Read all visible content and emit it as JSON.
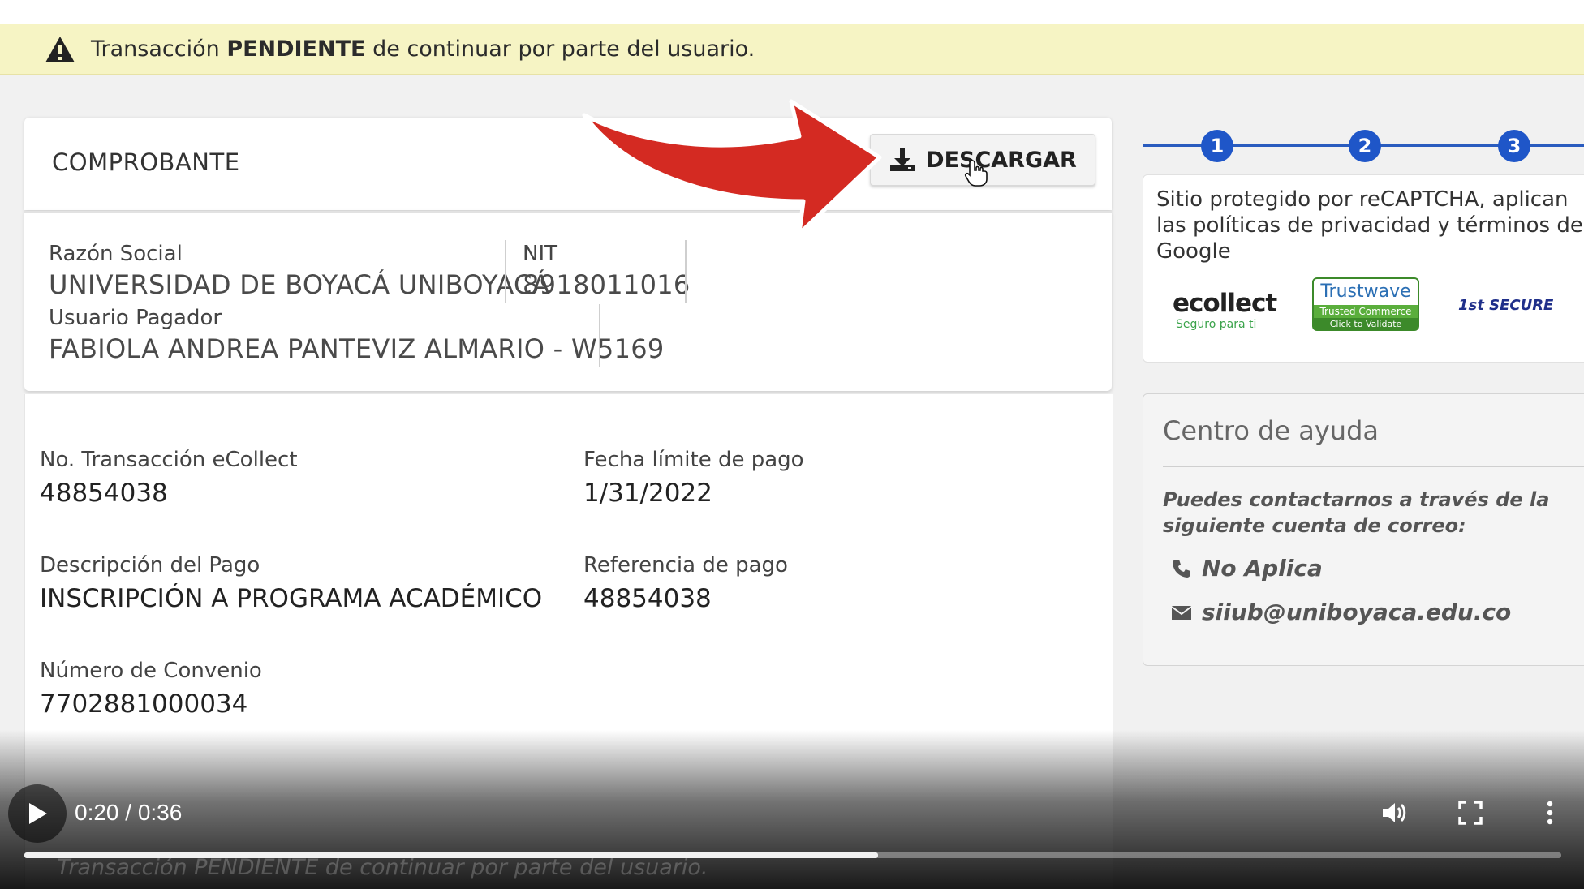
{
  "alert": {
    "prefix": "Transacción",
    "status": "PENDIENTE",
    "suffix": "de continuar por parte del usuario."
  },
  "receipt": {
    "title": "COMPROBANTE",
    "download_label": "DESCARGAR",
    "razon_social_label": "Razón Social",
    "razon_social_value": "UNIVERSIDAD DE BOYACÁ UNIBOYACÁ",
    "nit_label": "NIT",
    "nit_value": "8918011016",
    "usuario_label": "Usuario Pagador",
    "usuario_value": "FABIOLA ANDREA PANTEVIZ ALMARIO - W5169"
  },
  "details": {
    "transaction_label": "No. Transacción eCollect",
    "transaction_value": "48854038",
    "deadline_label": "Fecha límite de pago",
    "deadline_value": "1/31/2022",
    "description_label": "Descripción del Pago",
    "description_value": "INSCRIPCIÓN A PROGRAMA ACADÉMICO",
    "reference_label": "Referencia de pago",
    "reference_value": "48854038",
    "agreement_label": "Número de Convenio",
    "agreement_value": "7702881000034"
  },
  "steps": [
    "1",
    "2",
    "3"
  ],
  "recaptcha": {
    "text": "Sitio protegido por reCAPTCHA, aplican las políticas de privacidad y términos de Google"
  },
  "logos": {
    "ecollect_name": "ecollect",
    "ecollect_slogan": "Seguro para ti",
    "trustwave_name": "Trustwave",
    "trustwave_line1": "Trusted Commerce",
    "trustwave_line2": "Click to Validate",
    "secure_name": "1st SECURE"
  },
  "help": {
    "title": "Centro de ayuda",
    "hint": "Puedes contactarnos a través de la siguiente cuenta de correo:",
    "phone": "No Aplica",
    "email": "siiub@uniboyaca.edu.co"
  },
  "video": {
    "time_display": "0:20 / 0:36",
    "progress_fraction": 0.5556,
    "ghost_caption": "Transacción PENDIENTE de continuar por parte del usuario."
  },
  "colors": {
    "alert_bg": "#f6f4c4",
    "step_blue": "#1f56c8",
    "arrow_red": "#d42a22"
  }
}
